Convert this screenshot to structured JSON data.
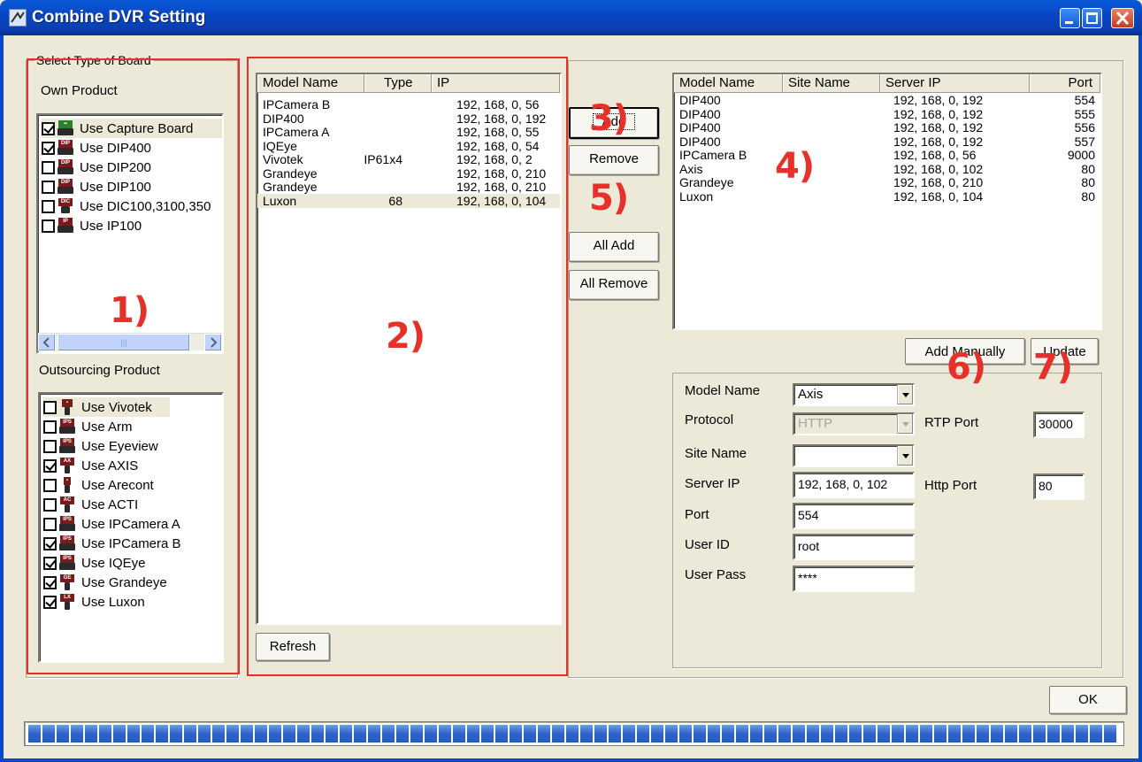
{
  "window": {
    "title": "Combine DVR Setting"
  },
  "board_group": {
    "label": "Select Type of Board"
  },
  "own_product": {
    "label": "Own Product",
    "items": [
      {
        "label": "Use Capture Board",
        "checked": true,
        "icon": "capture-board-icon"
      },
      {
        "label": "Use DIP400",
        "checked": true,
        "icon": "dip400-icon"
      },
      {
        "label": "Use DIP200",
        "checked": false,
        "icon": "dip200-icon"
      },
      {
        "label": "Use DIP100",
        "checked": false,
        "icon": "dip100-icon"
      },
      {
        "label": "Use DIC100,3100,350",
        "checked": false,
        "icon": "dic-icon"
      },
      {
        "label": "Use IP100",
        "checked": false,
        "icon": "ip100-icon"
      }
    ]
  },
  "outsourcing_product": {
    "label": "Outsourcing Product",
    "items": [
      {
        "label": "Use Vivotek",
        "checked": false
      },
      {
        "label": "Use Arm",
        "checked": false
      },
      {
        "label": "Use Eyeview",
        "checked": false
      },
      {
        "label": "Use AXIS",
        "checked": true
      },
      {
        "label": "Use Arecont",
        "checked": false
      },
      {
        "label": "Use ACTI",
        "checked": false
      },
      {
        "label": "Use IPCamera A",
        "checked": false
      },
      {
        "label": "Use IPCamera B",
        "checked": true
      },
      {
        "label": "Use IQEye",
        "checked": true
      },
      {
        "label": "Use Grandeye",
        "checked": true
      },
      {
        "label": "Use Luxon",
        "checked": true
      }
    ]
  },
  "found_list": {
    "columns": [
      "Model Name",
      "Type",
      "IP"
    ],
    "rows": [
      [
        "IPCamera B",
        "",
        "192, 168, 0, 56"
      ],
      [
        "DIP400",
        "",
        "192, 168, 0, 192"
      ],
      [
        "IPCamera A",
        "",
        "192, 168, 0, 55"
      ],
      [
        "IQEye",
        "",
        "192, 168, 0, 54"
      ],
      [
        "Vivotek",
        "IP61x4",
        "192, 168, 0, 2"
      ],
      [
        "Grandeye",
        "",
        "192, 168, 0, 210"
      ],
      [
        "Grandeye",
        "",
        "192, 168, 0, 210"
      ],
      [
        "Luxon",
        "68",
        "192, 168, 0, 104"
      ]
    ],
    "refresh_label": "Refresh"
  },
  "transfer_buttons": {
    "add": "Add",
    "remove": "Remove",
    "all_add": "All Add",
    "all_remove": "All Remove"
  },
  "added_list": {
    "columns": [
      "Model Name",
      "Site Name",
      "Server IP",
      "Port"
    ],
    "rows": [
      [
        "DIP400",
        "",
        "192, 168, 0, 192",
        "554"
      ],
      [
        "DIP400",
        "",
        "192, 168, 0, 192",
        "555"
      ],
      [
        "DIP400",
        "",
        "192, 168, 0, 192",
        "556"
      ],
      [
        "DIP400",
        "",
        "192, 168, 0, 192",
        "557"
      ],
      [
        "IPCamera B",
        "",
        "192, 168, 0, 56",
        "9000"
      ],
      [
        "Axis",
        "",
        "192, 168, 0, 102",
        "80"
      ],
      [
        "Grandeye",
        "",
        "192, 168, 0, 210",
        "80"
      ],
      [
        "Luxon",
        "",
        "192, 168, 0, 104",
        "80"
      ]
    ],
    "add_manually_label": "Add Manually",
    "update_label": "Update"
  },
  "form": {
    "model_name_label": "Model Name",
    "model_name_value": "Axis",
    "protocol_label": "Protocol",
    "protocol_value": "HTTP",
    "site_name_label": "Site Name",
    "site_name_value": "",
    "server_ip_label": "Server IP",
    "server_ip_value": "192, 168, 0, 102",
    "port_label": "Port",
    "port_value": "554",
    "user_id_label": "User ID",
    "user_id_value": "root",
    "user_pass_label": "User Pass",
    "user_pass_value": "****",
    "rtp_port_label": "RTP Port",
    "rtp_port_value": "30000",
    "http_port_label": "Http Port",
    "http_port_value": "80"
  },
  "ok_label": "OK",
  "annotations": [
    "1)",
    "2)",
    "3)",
    "4)",
    "5)",
    "6)",
    "7)"
  ],
  "progress": {
    "fraction": 1.0
  },
  "colors": {
    "annotation": "#e8302a",
    "titlebar": "#0a46c4",
    "progress": "#2d62c9"
  }
}
